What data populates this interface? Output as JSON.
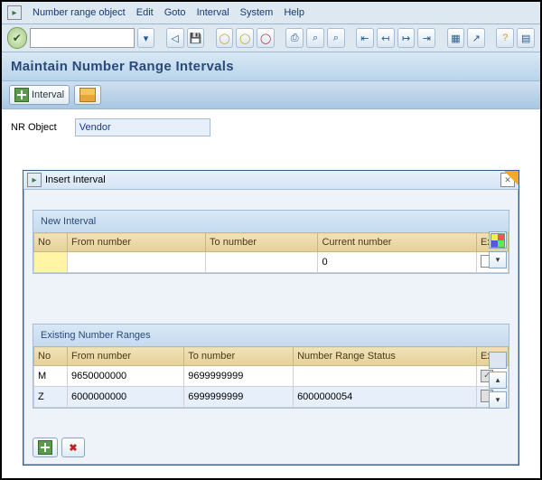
{
  "menu": {
    "items": [
      "Number range object",
      "Edit",
      "Goto",
      "Interval",
      "System",
      "Help"
    ]
  },
  "page": {
    "title": "Maintain Number Range Intervals"
  },
  "interval_button": "Interval",
  "form": {
    "nr_label": "NR Object",
    "nr_value": "Vendor"
  },
  "dialog": {
    "title": "Insert Interval",
    "new_section": "New Interval",
    "existing_section": "Existing Number Ranges",
    "cols_new": {
      "no": "No",
      "from": "From number",
      "to": "To number",
      "curr": "Current number",
      "ext": "Ext"
    },
    "cols_ex": {
      "no": "No",
      "from": "From number",
      "to": "To number",
      "status": "Number Range Status",
      "ext": "Ext"
    },
    "new_rows": [
      {
        "no": "",
        "from": "",
        "to": "",
        "curr": "0",
        "ext": false
      }
    ],
    "ex_rows": [
      {
        "no": "M",
        "from": "9650000000",
        "to": "9699999999",
        "status": "",
        "ext": true
      },
      {
        "no": "Z",
        "from": "6000000000",
        "to": "6999999999",
        "status": "6000000054",
        "ext": false
      }
    ]
  }
}
